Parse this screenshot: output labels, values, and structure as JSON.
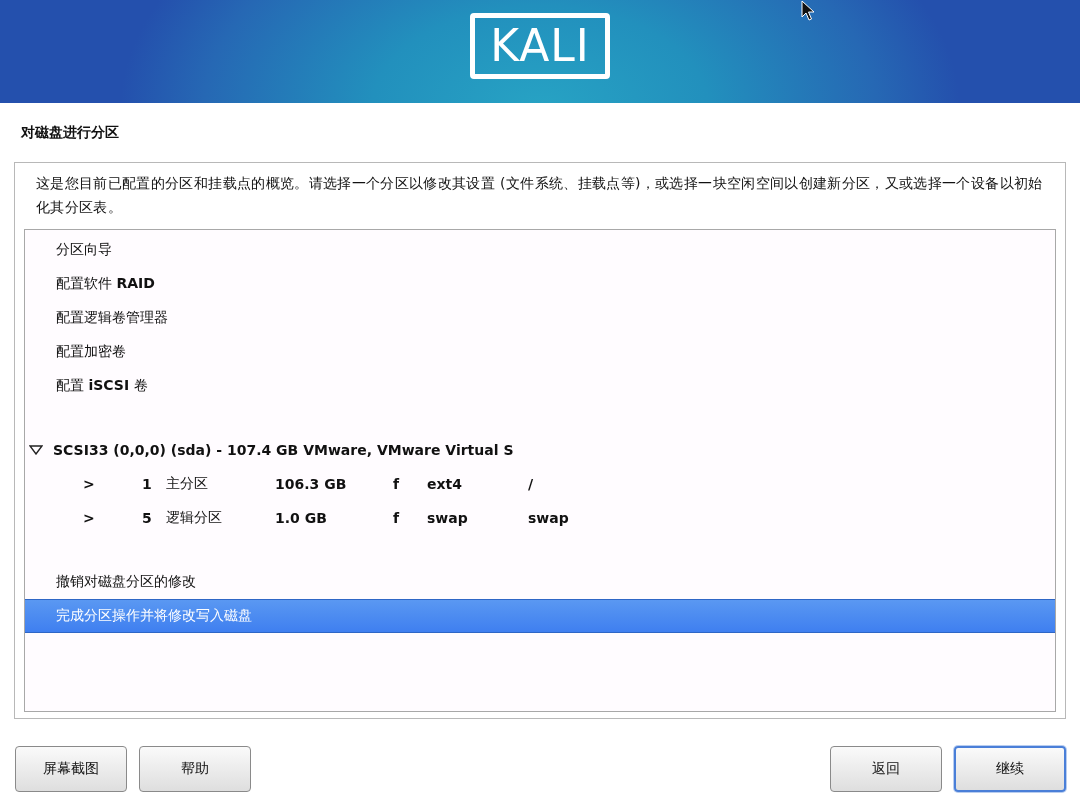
{
  "banner": {
    "logo": "KALI"
  },
  "title": "对磁盘进行分区",
  "description": "这是您目前已配置的分区和挂载点的概览。请选择一个分区以修改其设置 (文件系统、挂载点等)，或选择一块空闲空间以创建新分区，又或选择一个设备以初始化其分区表。",
  "list": {
    "items": [
      {
        "kind": "action",
        "label": "分区向导",
        "selected": false
      },
      {
        "kind": "action",
        "label": "配置软件 **RAID**",
        "selected": false
      },
      {
        "kind": "action",
        "label": "配置逻辑卷管理器",
        "selected": false
      },
      {
        "kind": "action",
        "label": "配置加密卷",
        "selected": false
      },
      {
        "kind": "action",
        "label": "配置 **iSCSI** 卷",
        "selected": false
      },
      {
        "kind": "disk",
        "label": "SCSI33 (0,0,0) (sda) - 107.4 GB VMware, VMware Virtual S",
        "expanded": true,
        "selected": false,
        "children": [
          {
            "arrow": ">",
            "number": "1",
            "type": "主分区",
            "size": "106.3 GB",
            "flag": "f",
            "filesystem": "ext4",
            "mount": "/",
            "selected": false
          },
          {
            "arrow": ">",
            "number": "5",
            "type": "逻辑分区",
            "size": "1.0 GB",
            "flag": "f",
            "filesystem": "swap",
            "mount": "swap",
            "selected": false
          }
        ]
      },
      {
        "kind": "action",
        "label": "撤销对磁盘分区的修改",
        "selected": false
      },
      {
        "kind": "action",
        "label": "完成分区操作并将修改写入磁盘",
        "selected": true
      }
    ]
  },
  "buttons_left": [
    {
      "label": "屏幕截图",
      "focused": false
    },
    {
      "label": "帮助",
      "focused": false
    }
  ],
  "buttons_right": [
    {
      "label": "返回",
      "focused": false
    },
    {
      "label": "继续",
      "focused": true
    }
  ]
}
